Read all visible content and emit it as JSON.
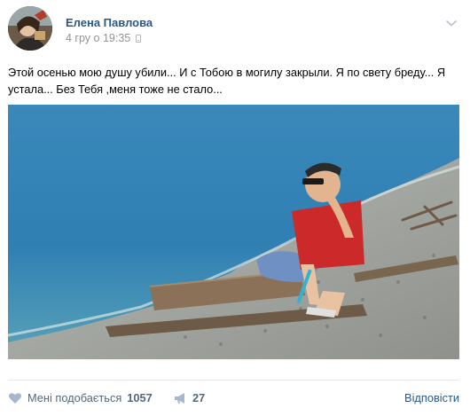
{
  "post": {
    "author": "Елена Павлова",
    "date": "4 гру о 19:35",
    "text": "Этой осенью мою душу убили... И с Тобою в могилу закрыли. Я по свету бреду... Я устала... Без Тебя ,меня тоже не стало...",
    "icons": {
      "device": "phone-icon",
      "menu": "chevron-down-icon",
      "like": "heart-icon",
      "share": "megaphone-icon"
    }
  },
  "actions": {
    "like_label": "Мені подобається",
    "like_count": "1057",
    "share_count": "27",
    "reply_label": "Відповісти"
  },
  "colors": {
    "link": "#2a5885",
    "muted": "#939393",
    "action": "#55677d",
    "divider": "#e7e8ec"
  }
}
